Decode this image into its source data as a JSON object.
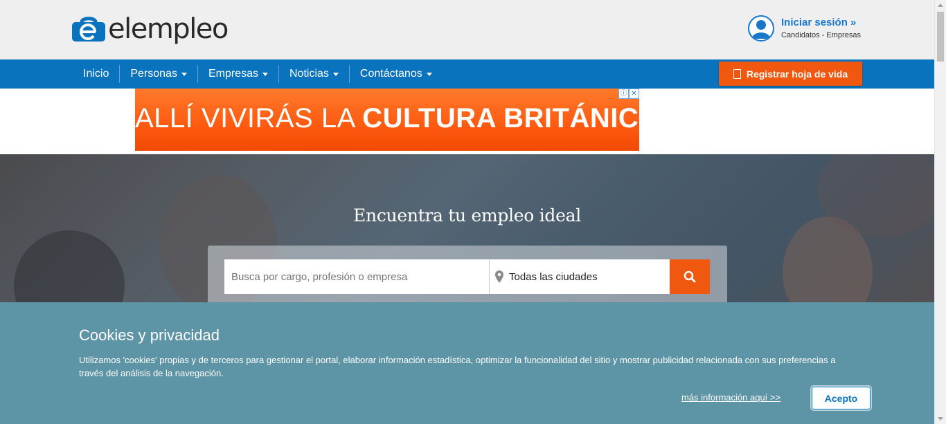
{
  "header": {
    "logo_text": "elempleo",
    "login_title": "Iniciar sesión »",
    "login_sub": "Candidatos - Empresas"
  },
  "nav": {
    "items": [
      {
        "label": "Inicio",
        "has_caret": false
      },
      {
        "label": "Personas",
        "has_caret": true
      },
      {
        "label": "Empresas",
        "has_caret": true
      },
      {
        "label": "Noticias",
        "has_caret": true
      },
      {
        "label": "Contáctanos",
        "has_caret": true
      }
    ],
    "register_label": "Registrar hoja de vida"
  },
  "ad": {
    "text_light": "ALLÍ VIVIRÁS LA",
    "text_bold": "CULTURA BRITÁNICA",
    "info_glyph": "ⓘ",
    "close_glyph": "✕"
  },
  "hero": {
    "title": "Encuentra tu empleo ideal",
    "search_placeholder": "Busca por cargo, profesión o empresa",
    "city_value": "Todas las ciudades"
  },
  "cookie": {
    "title": "Cookies y privacidad",
    "text": "Utilizamos 'cookies' propias y de terceros para gestionar el portal, elaborar información estadística, optimizar la funcionalidad del sitio y mostrar publicidad relacionada con sus preferencias a través del análisis de la navegación.",
    "more_link": "más información aquí >>",
    "accept_label": "Acepto"
  },
  "colors": {
    "brand_blue": "#0a73be",
    "accent_orange": "#f0570f",
    "cookie_bg": "#5e95a6"
  }
}
